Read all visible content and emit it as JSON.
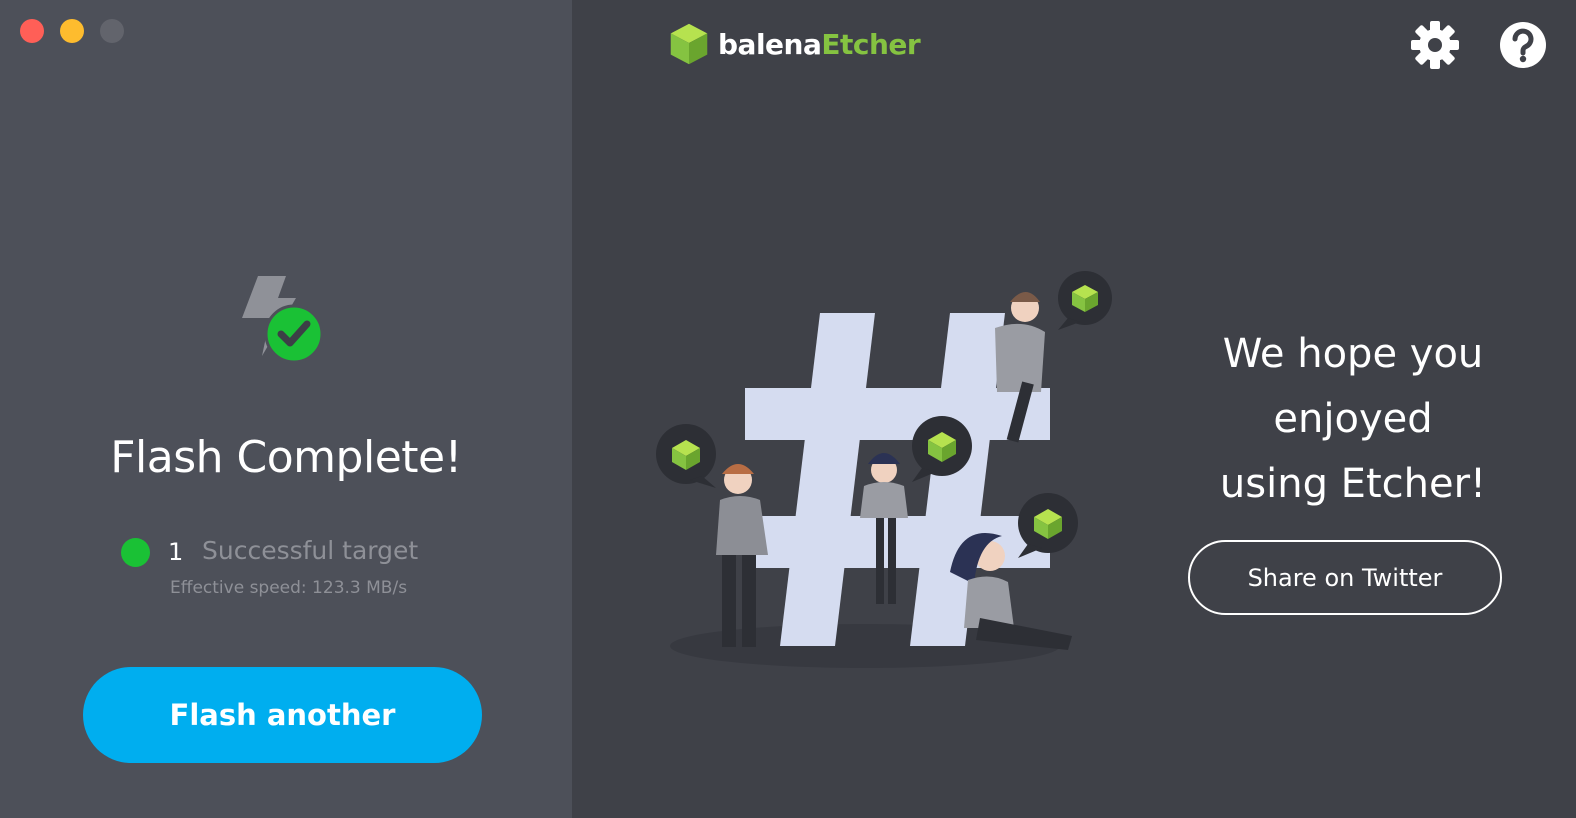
{
  "window": {
    "controls": [
      "close",
      "minimize",
      "maximize"
    ]
  },
  "status": {
    "title": "Flash Complete!",
    "success_count": "1",
    "success_label": "Successful target",
    "speed": "Effective speed: 123.3 MB/s"
  },
  "actions": {
    "flash_another": "Flash another",
    "share_twitter": "Share on Twitter"
  },
  "brand": {
    "name_part1": "balena",
    "name_part2": "Etcher"
  },
  "header_icons": [
    "gear-icon",
    "help-icon"
  ],
  "message": {
    "line1": "We hope you",
    "line2": "enjoyed",
    "line3": "using Etcher!"
  },
  "colors": {
    "accent_blue": "#00aeef",
    "success_green": "#1ac135",
    "brand_green": "#85c341",
    "panel_left": "#4d5059",
    "panel_right": "#3f4148"
  }
}
